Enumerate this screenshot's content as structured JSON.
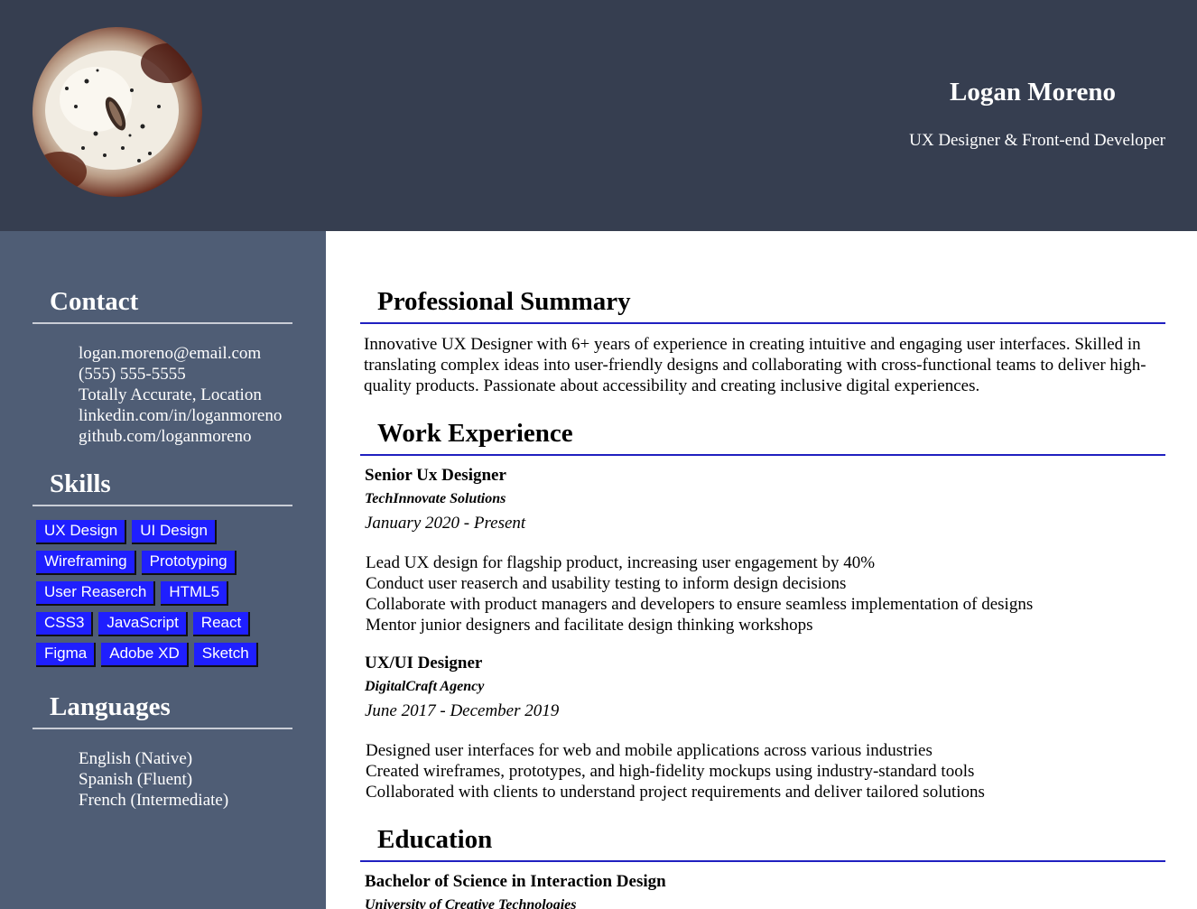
{
  "header": {
    "name": "Logan Moreno",
    "title": "UX Designer & Front-end Developer"
  },
  "colors": {
    "header_bg": "#363e50",
    "sidebar_bg": "#4f5d75",
    "skill_badge": "#1f1fff",
    "section_rule": "#2020c0"
  },
  "sidebar": {
    "contact": {
      "heading": "Contact",
      "items": [
        "logan.moreno@email.com",
        "(555) 555-5555",
        "Totally Accurate, Location",
        "linkedin.com/in/loganmoreno",
        "github.com/loganmoreno"
      ]
    },
    "skills": {
      "heading": "Skills",
      "rows": [
        [
          "UX Design",
          "UI Design"
        ],
        [
          "Wireframing",
          "Prototyping"
        ],
        [
          "User Reaserch",
          "HTML5"
        ],
        [
          "CSS3",
          "JavaScript",
          "React"
        ],
        [
          "Figma",
          "Adobe XD",
          "Sketch"
        ]
      ]
    },
    "languages": {
      "heading": "Languages",
      "items": [
        "English (Native)",
        "Spanish (Fluent)",
        "French (Intermediate)"
      ]
    }
  },
  "main": {
    "summary": {
      "heading": "Professional Summary",
      "text": "Innovative UX Designer with 6+ years of experience in creating intuitive and engaging user interfaces. Skilled in translating complex ideas into user-friendly designs and collaborating with cross-functional teams to deliver high-quality products. Passionate about accessibility and creating inclusive digital experiences."
    },
    "experience": {
      "heading": "Work Experience",
      "jobs": [
        {
          "title": "Senior Ux Designer",
          "company": "TechInnovate Solutions",
          "dates": "January 2020 - Present",
          "duties": [
            "Lead UX design for flagship product, increasing user engagement by 40%",
            "Conduct user reaserch and usability testing to inform design decisions",
            "Collaborate with product managers and developers to ensure seamless implementation of designs",
            "Mentor junior designers and facilitate design thinking workshops"
          ]
        },
        {
          "title": "UX/UI Designer",
          "company": "DigitalCraft Agency",
          "dates": "June 2017 - December 2019",
          "duties": [
            "Designed user interfaces for web and mobile applications across various industries",
            "Created wireframes, prototypes, and high-fidelity mockups using industry-standard tools",
            "Collaborated with clients to understand project requirements and deliver tailored solutions"
          ]
        }
      ]
    },
    "education": {
      "heading": "Education",
      "degree": "Bachelor of Science in Interaction Design",
      "school": "University of Creative Technologies"
    }
  }
}
